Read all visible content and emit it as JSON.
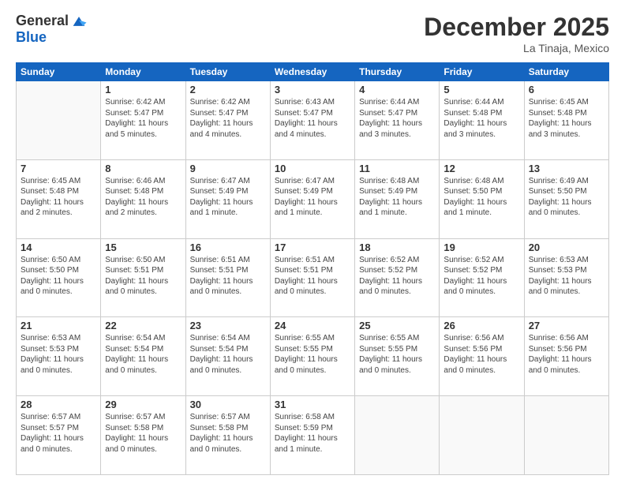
{
  "logo": {
    "general": "General",
    "blue": "Blue"
  },
  "header": {
    "title": "December 2025",
    "location": "La Tinaja, Mexico"
  },
  "days_of_week": [
    "Sunday",
    "Monday",
    "Tuesday",
    "Wednesday",
    "Thursday",
    "Friday",
    "Saturday"
  ],
  "weeks": [
    [
      {
        "day": "",
        "content": ""
      },
      {
        "day": "1",
        "content": "Sunrise: 6:42 AM\nSunset: 5:47 PM\nDaylight: 11 hours\nand 5 minutes."
      },
      {
        "day": "2",
        "content": "Sunrise: 6:42 AM\nSunset: 5:47 PM\nDaylight: 11 hours\nand 4 minutes."
      },
      {
        "day": "3",
        "content": "Sunrise: 6:43 AM\nSunset: 5:47 PM\nDaylight: 11 hours\nand 4 minutes."
      },
      {
        "day": "4",
        "content": "Sunrise: 6:44 AM\nSunset: 5:47 PM\nDaylight: 11 hours\nand 3 minutes."
      },
      {
        "day": "5",
        "content": "Sunrise: 6:44 AM\nSunset: 5:48 PM\nDaylight: 11 hours\nand 3 minutes."
      },
      {
        "day": "6",
        "content": "Sunrise: 6:45 AM\nSunset: 5:48 PM\nDaylight: 11 hours\nand 3 minutes."
      }
    ],
    [
      {
        "day": "7",
        "content": "Sunrise: 6:45 AM\nSunset: 5:48 PM\nDaylight: 11 hours\nand 2 minutes."
      },
      {
        "day": "8",
        "content": "Sunrise: 6:46 AM\nSunset: 5:48 PM\nDaylight: 11 hours\nand 2 minutes."
      },
      {
        "day": "9",
        "content": "Sunrise: 6:47 AM\nSunset: 5:49 PM\nDaylight: 11 hours\nand 1 minute."
      },
      {
        "day": "10",
        "content": "Sunrise: 6:47 AM\nSunset: 5:49 PM\nDaylight: 11 hours\nand 1 minute."
      },
      {
        "day": "11",
        "content": "Sunrise: 6:48 AM\nSunset: 5:49 PM\nDaylight: 11 hours\nand 1 minute."
      },
      {
        "day": "12",
        "content": "Sunrise: 6:48 AM\nSunset: 5:50 PM\nDaylight: 11 hours\nand 1 minute."
      },
      {
        "day": "13",
        "content": "Sunrise: 6:49 AM\nSunset: 5:50 PM\nDaylight: 11 hours\nand 0 minutes."
      }
    ],
    [
      {
        "day": "14",
        "content": "Sunrise: 6:50 AM\nSunset: 5:50 PM\nDaylight: 11 hours\nand 0 minutes."
      },
      {
        "day": "15",
        "content": "Sunrise: 6:50 AM\nSunset: 5:51 PM\nDaylight: 11 hours\nand 0 minutes."
      },
      {
        "day": "16",
        "content": "Sunrise: 6:51 AM\nSunset: 5:51 PM\nDaylight: 11 hours\nand 0 minutes."
      },
      {
        "day": "17",
        "content": "Sunrise: 6:51 AM\nSunset: 5:51 PM\nDaylight: 11 hours\nand 0 minutes."
      },
      {
        "day": "18",
        "content": "Sunrise: 6:52 AM\nSunset: 5:52 PM\nDaylight: 11 hours\nand 0 minutes."
      },
      {
        "day": "19",
        "content": "Sunrise: 6:52 AM\nSunset: 5:52 PM\nDaylight: 11 hours\nand 0 minutes."
      },
      {
        "day": "20",
        "content": "Sunrise: 6:53 AM\nSunset: 5:53 PM\nDaylight: 11 hours\nand 0 minutes."
      }
    ],
    [
      {
        "day": "21",
        "content": "Sunrise: 6:53 AM\nSunset: 5:53 PM\nDaylight: 11 hours\nand 0 minutes."
      },
      {
        "day": "22",
        "content": "Sunrise: 6:54 AM\nSunset: 5:54 PM\nDaylight: 11 hours\nand 0 minutes."
      },
      {
        "day": "23",
        "content": "Sunrise: 6:54 AM\nSunset: 5:54 PM\nDaylight: 11 hours\nand 0 minutes."
      },
      {
        "day": "24",
        "content": "Sunrise: 6:55 AM\nSunset: 5:55 PM\nDaylight: 11 hours\nand 0 minutes."
      },
      {
        "day": "25",
        "content": "Sunrise: 6:55 AM\nSunset: 5:55 PM\nDaylight: 11 hours\nand 0 minutes."
      },
      {
        "day": "26",
        "content": "Sunrise: 6:56 AM\nSunset: 5:56 PM\nDaylight: 11 hours\nand 0 minutes."
      },
      {
        "day": "27",
        "content": "Sunrise: 6:56 AM\nSunset: 5:56 PM\nDaylight: 11 hours\nand 0 minutes."
      }
    ],
    [
      {
        "day": "28",
        "content": "Sunrise: 6:57 AM\nSunset: 5:57 PM\nDaylight: 11 hours\nand 0 minutes."
      },
      {
        "day": "29",
        "content": "Sunrise: 6:57 AM\nSunset: 5:58 PM\nDaylight: 11 hours\nand 0 minutes."
      },
      {
        "day": "30",
        "content": "Sunrise: 6:57 AM\nSunset: 5:58 PM\nDaylight: 11 hours\nand 0 minutes."
      },
      {
        "day": "31",
        "content": "Sunrise: 6:58 AM\nSunset: 5:59 PM\nDaylight: 11 hours\nand 1 minute."
      },
      {
        "day": "",
        "content": ""
      },
      {
        "day": "",
        "content": ""
      },
      {
        "day": "",
        "content": ""
      }
    ]
  ]
}
